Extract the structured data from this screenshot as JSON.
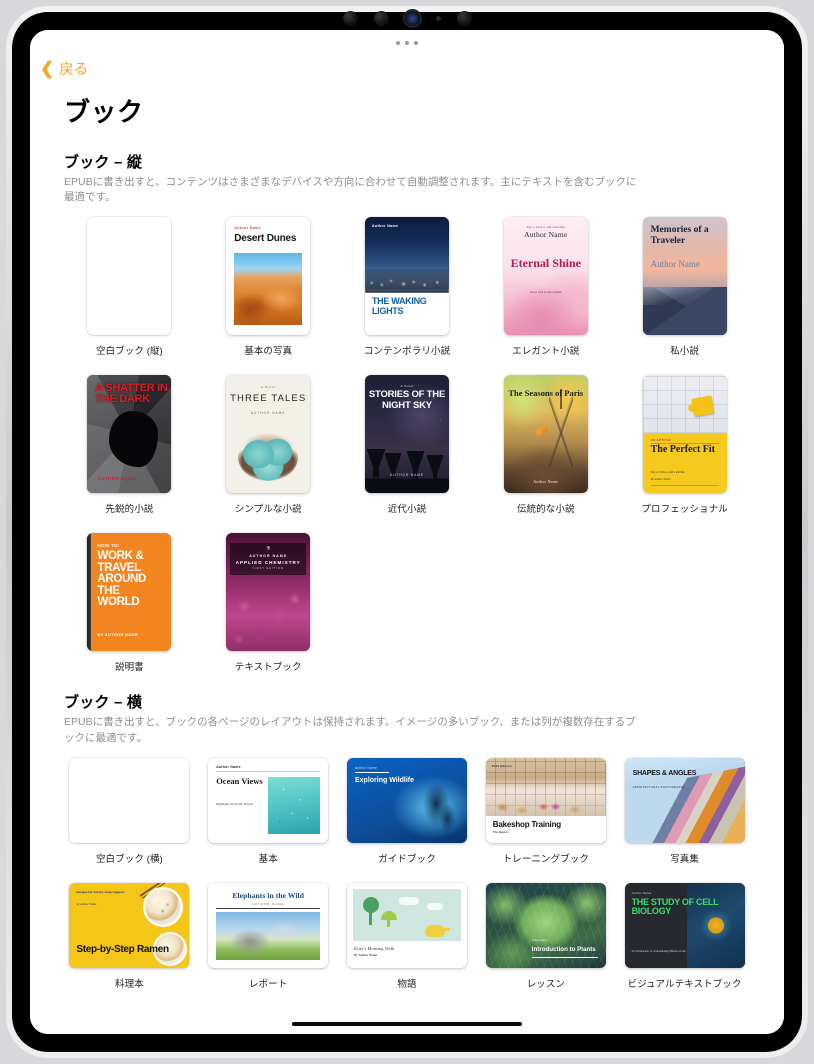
{
  "device": {
    "camera_icons": [
      "camera-lens",
      "camera-lens",
      "flash-lens",
      "microphone",
      "camera-lens"
    ],
    "home_indicator": "home-indicator"
  },
  "nav": {
    "back_label": "戻る",
    "back_icon": "chevron-left-icon",
    "drag_handle_icon": "drag-handle-icon"
  },
  "page": {
    "title": "ブック"
  },
  "accent_color": "#f5a623",
  "sections": [
    {
      "title": "ブック – 縦",
      "description": "EPUBに書き出すと、コンテンツはさまざまなデバイスや方向に合わせて自動調整されます。主にテキストを含むブックに最適です。",
      "orientation": "portrait",
      "templates": [
        {
          "label": "空白ブック (縦)",
          "cover": "blank"
        },
        {
          "label": "基本の写真",
          "cover": "desert",
          "cover_texts": {
            "author": "Author Name",
            "title": "Desert Dunes"
          }
        },
        {
          "label": "コンテンポラリ小説",
          "cover": "waking",
          "cover_texts": {
            "author": "Author Name",
            "title": "THE WAKING LIGHTS"
          }
        },
        {
          "label": "エレガント小説",
          "cover": "eternal",
          "cover_texts": {
            "heading_hint": "Tap or click to add a heading",
            "author": "Author Name",
            "title": "Eternal Shine",
            "subtitle_hint": "Tap or click to add a subtitle"
          }
        },
        {
          "label": "私小説",
          "cover": "memories",
          "cover_texts": {
            "title": "Memories of a Traveler",
            "author": "Author Name"
          }
        },
        {
          "label": "先鋭的小説",
          "cover": "shatter",
          "cover_texts": {
            "title": "A SHATTER IN THE DARK",
            "author": "AUTHOR NAME"
          }
        },
        {
          "label": "シンプルな小説",
          "cover": "three",
          "cover_texts": {
            "kicker": "A Novel",
            "title": "THREE TALES",
            "author": "AUTHOR NAME"
          }
        },
        {
          "label": "近代小説",
          "cover": "night",
          "cover_texts": {
            "kicker": "A Novel",
            "title": "STORIES OF THE NIGHT SKY",
            "author": "AUTHOR NAME"
          }
        },
        {
          "label": "伝統的な小説",
          "cover": "paris",
          "cover_texts": {
            "title": "The Seasons of Paris",
            "author": "Author Name"
          }
        },
        {
          "label": "プロフェッショナル",
          "cover": "perfect",
          "cover_texts": {
            "kicker": "AN ARTICLE",
            "title": "The Perfect Fit",
            "subtitle": "Tap or click to add a subtitle",
            "author": "By Author Name"
          }
        },
        {
          "label": "説明書",
          "cover": "howto",
          "cover_texts": {
            "kicker": "HOW TO:",
            "title": "WORK & TRAVEL AROUND THE WORLD",
            "author": "BY AUTHOR NAME"
          }
        },
        {
          "label": "テキストブック",
          "cover": "chem",
          "cover_texts": {
            "logo": "⚗",
            "author": "AUTHOR NAME",
            "title": "APPLIED CHEMISTRY",
            "edition": "FIRST EDITION"
          }
        }
      ]
    },
    {
      "title": "ブック – 横",
      "description": "EPUBに書き出すと、ブックの各ページのレイアウトは保持されます。イメージの多いブック、または列が複数存在するブックに最適です。",
      "orientation": "landscape",
      "templates": [
        {
          "label": "空白ブック (横)",
          "cover": "blank"
        },
        {
          "label": "基本",
          "cover": "ocean",
          "cover_texts": {
            "author": "Author Name",
            "title": "Ocean Views",
            "subtitle": "Highlights From My Travels"
          }
        },
        {
          "label": "ガイドブック",
          "cover": "wild",
          "cover_texts": {
            "author": "Author Name",
            "title": "Exploring Wildlife"
          }
        },
        {
          "label": "トレーニングブック",
          "cover": "bake",
          "cover_texts": {
            "edition": "2024 Edition",
            "title": "Bakeshop Training",
            "subtitle": "The Basics"
          }
        },
        {
          "label": "写真集",
          "cover": "shapes",
          "cover_texts": {
            "title": "SHAPES & ANGLES",
            "subtitle": "ARCHITECTURAL PHOTOGRAPHY"
          }
        },
        {
          "label": "料理本",
          "cover": "ramen",
          "cover_texts": {
            "kicker": "Recipes for Savory Soup Suppers",
            "author": "by Author Name",
            "title": "Step-by-Step Ramen"
          }
        },
        {
          "label": "レポート",
          "cover": "eleph",
          "cover_texts": {
            "title": "Elephants in the Wild",
            "author": "AUTHOR NAME"
          }
        },
        {
          "label": "物語",
          "cover": "kitty",
          "cover_texts": {
            "title": "Kitty's Morning Walk",
            "author": "By Author Name"
          }
        },
        {
          "label": "レッスン",
          "cover": "plants",
          "cover_texts": {
            "author": "Author Name",
            "title": "Introduction to Plants"
          }
        },
        {
          "label": "ビジュアルテキストブック",
          "cover": "cell",
          "cover_texts": {
            "author": "Author Name",
            "title": "THE STUDY OF CELL BIOLOGY",
            "subtitle": "An Introduction to Understanding Blocks of Life"
          }
        }
      ]
    }
  ]
}
